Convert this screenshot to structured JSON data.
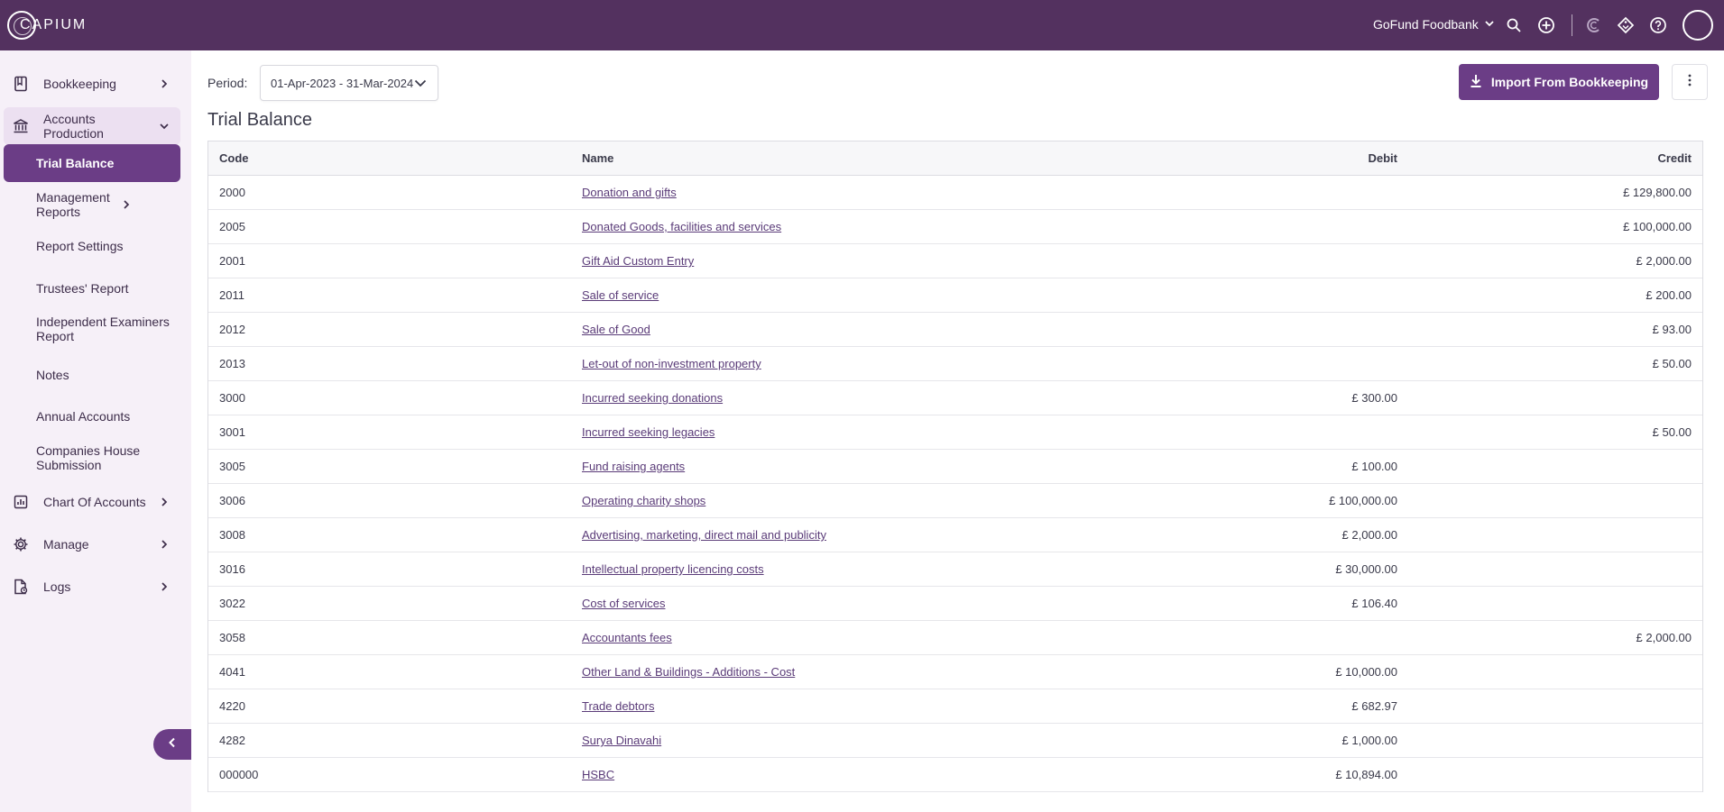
{
  "app": {
    "logo_text": "CAPIUM"
  },
  "header": {
    "organisation": "GoFund Foodbank",
    "icons": [
      "search-icon",
      "add-circle-icon",
      "capium-c-icon",
      "tag-icon",
      "help-icon"
    ]
  },
  "sidebar": {
    "items": [
      {
        "label": "Bookkeeping",
        "icon": "book-icon"
      },
      {
        "label": "Accounts Production",
        "icon": "bank-icon"
      },
      {
        "label": "Chart Of Accounts",
        "icon": "chart-icon"
      },
      {
        "label": "Manage",
        "icon": "gear-icon"
      },
      {
        "label": "Logs",
        "icon": "log-icon"
      }
    ],
    "sub_items": [
      {
        "label": "Trial Balance"
      },
      {
        "label": "Management Reports"
      },
      {
        "label": "Report Settings"
      },
      {
        "label": "Trustees' Report"
      },
      {
        "label": "Independent Examiners Report"
      },
      {
        "label": "Notes"
      },
      {
        "label": "Annual Accounts"
      },
      {
        "label": "Companies House Submission"
      }
    ]
  },
  "toolbar": {
    "period_label": "Period:",
    "period_value": "01-Apr-2023 - 31-Mar-2024",
    "import_label": "Import From Bookkeeping"
  },
  "page": {
    "title": "Trial Balance"
  },
  "table": {
    "headers": {
      "code": "Code",
      "name": "Name",
      "debit": "Debit",
      "credit": "Credit"
    },
    "rows": [
      {
        "code": "2000",
        "name": "Donation and gifts",
        "debit": "",
        "credit": "£ 129,800.00"
      },
      {
        "code": "2005",
        "name": "Donated Goods, facilities and services",
        "debit": "",
        "credit": "£ 100,000.00"
      },
      {
        "code": "2001",
        "name": "Gift Aid Custom Entry",
        "debit": "",
        "credit": "£ 2,000.00"
      },
      {
        "code": "2011",
        "name": "Sale of service",
        "debit": "",
        "credit": "£ 200.00"
      },
      {
        "code": "2012",
        "name": "Sale of Good",
        "debit": "",
        "credit": "£ 93.00"
      },
      {
        "code": "2013",
        "name": "Let-out of non-investment property",
        "debit": "",
        "credit": "£ 50.00"
      },
      {
        "code": "3000",
        "name": "Incurred seeking donations",
        "debit": "£ 300.00",
        "credit": ""
      },
      {
        "code": "3001",
        "name": "Incurred seeking legacies",
        "debit": "",
        "credit": "£ 50.00"
      },
      {
        "code": "3005",
        "name": "Fund raising agents",
        "debit": "£ 100.00",
        "credit": ""
      },
      {
        "code": "3006",
        "name": "Operating charity shops",
        "debit": "£ 100,000.00",
        "credit": ""
      },
      {
        "code": "3008",
        "name": "Advertising, marketing, direct mail and publicity",
        "debit": "£ 2,000.00",
        "credit": ""
      },
      {
        "code": "3016",
        "name": "Intellectual property licencing costs",
        "debit": "£ 30,000.00",
        "credit": ""
      },
      {
        "code": "3022",
        "name": "Cost of services",
        "debit": "£ 106.40",
        "credit": ""
      },
      {
        "code": "3058",
        "name": "Accountants fees",
        "debit": "",
        "credit": "£ 2,000.00"
      },
      {
        "code": "4041",
        "name": "Other Land & Buildings - Additions - Cost",
        "debit": "£ 10,000.00",
        "credit": ""
      },
      {
        "code": "4220",
        "name": "Trade debtors",
        "debit": "£ 682.97",
        "credit": ""
      },
      {
        "code": "4282",
        "name": "Surya Dinavahi",
        "debit": "£ 1,000.00",
        "credit": ""
      },
      {
        "code": "000000",
        "name": "HSBC",
        "debit": "£ 10,894.00",
        "credit": ""
      }
    ]
  }
}
